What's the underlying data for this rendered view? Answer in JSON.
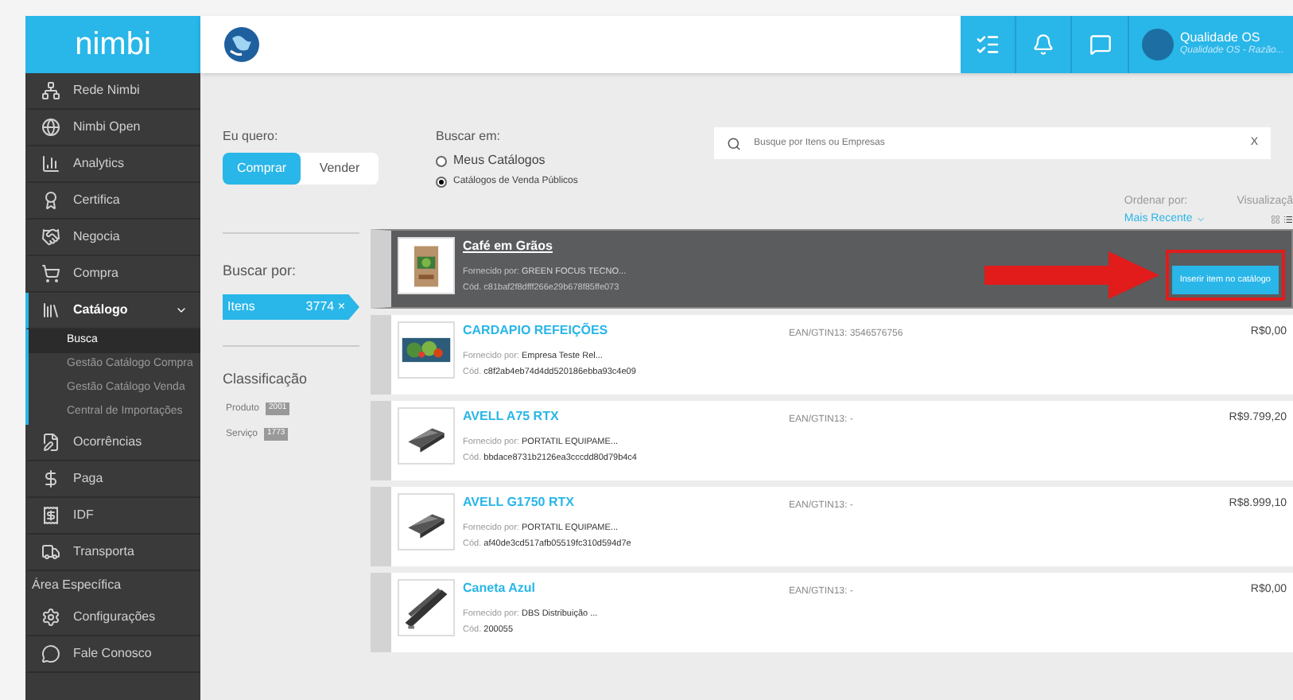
{
  "sidebar": {
    "logo": "nimbi",
    "items": [
      {
        "label": "Rede Nimbi",
        "selected": false
      },
      {
        "label": "Nimbi Open",
        "selected": false
      },
      {
        "label": "Analytics",
        "selected": false
      },
      {
        "label": "Certifica",
        "selected": false
      },
      {
        "label": "Negocia",
        "selected": false
      },
      {
        "label": "Compra",
        "selected": false
      },
      {
        "label": "Catálogo",
        "selected": true,
        "expanded": true,
        "children": [
          {
            "label": "Busca",
            "selected": true
          },
          {
            "label": "Gestão Catálogo Compra",
            "selected": false
          },
          {
            "label": "Gestão Catálogo Venda",
            "selected": false
          },
          {
            "label": "Central de Importações",
            "selected": false
          }
        ]
      },
      {
        "label": "Ocorrências",
        "selected": false
      },
      {
        "label": "Paga",
        "selected": false
      },
      {
        "label": "IDF",
        "selected": false
      },
      {
        "label": "Transporta",
        "selected": false
      }
    ],
    "section": "Área Específica",
    "section_items": [
      {
        "label": "Configurações",
        "selected": false
      },
      {
        "label": "Fale Conosco",
        "selected": false
      }
    ]
  },
  "header": {
    "user": {
      "name": "Qualidade OS",
      "company": "Qualidade OS - Razão..."
    }
  },
  "mode": {
    "label": "Eu quero:",
    "options": [
      {
        "label": "Comprar",
        "selected": true
      },
      {
        "label": "Vender",
        "selected": false
      }
    ]
  },
  "scope": {
    "label": "Buscar em:",
    "options": [
      {
        "label": "Meus Catálogos",
        "selected": false
      },
      {
        "label": "Catálogos de Venda Públicos",
        "selected": true
      }
    ]
  },
  "search": {
    "placeholder": "Busque por Itens ou Empresas",
    "clear": "X"
  },
  "sort": {
    "label": "Ordenar por:",
    "value": "Mais Recente",
    "view_label": "Visualizaçã"
  },
  "filters": {
    "label": "Buscar por:",
    "tab": {
      "label": "Itens",
      "count": "3774",
      "remove": "×",
      "selected": true
    },
    "classification": {
      "label": "Classificação",
      "options": [
        {
          "label": "Produto",
          "count": "2001"
        },
        {
          "label": "Serviço",
          "count": "1773"
        }
      ]
    }
  },
  "results": [
    {
      "title": "Café em Grãos",
      "highlighted": true,
      "supplier_label": "Fornecido por:",
      "supplier": "GREEN FOCUS TECNO...",
      "code": "Cód. c81baf2f8dfff266e29b678f85ffe073",
      "action": "Inserir item no catálogo"
    },
    {
      "title": "CARDAPIO REFEIÇÕES",
      "highlighted": false,
      "supplier_label": "Fornecido por:",
      "supplier": "Empresa Teste Rel...",
      "code_label": "Cód.",
      "code": "c8f2ab4eb74d4dd520186ebba93c4e09",
      "ean": "EAN/GTIN13: 3546576756",
      "price": "R$0,00"
    },
    {
      "title": "AVELL A75 RTX",
      "highlighted": false,
      "supplier_label": "Fornecido por:",
      "supplier": "PORTATIL EQUIPAME...",
      "code_label": "Cód.",
      "code": "bbdace8731b2126ea3cccdd80d79b4c4",
      "ean": "EAN/GTIN13: -",
      "price": "R$9.799,20"
    },
    {
      "title": "AVELL G1750 RTX",
      "highlighted": false,
      "supplier_label": "Fornecido por:",
      "supplier": "PORTATIL EQUIPAME...",
      "code_label": "Cód.",
      "code": "af40de3cd517afb05519fc310d594d7e",
      "ean": "EAN/GTIN13: -",
      "price": "R$8.999,10"
    },
    {
      "title": "Caneta Azul",
      "highlighted": false,
      "supplier_label": "Fornecido por:",
      "supplier": "DBS Distribuição ...",
      "code_label": "Cód.",
      "code": "200055",
      "ean": "EAN/GTIN13: -",
      "price": "R$0,00"
    }
  ]
}
